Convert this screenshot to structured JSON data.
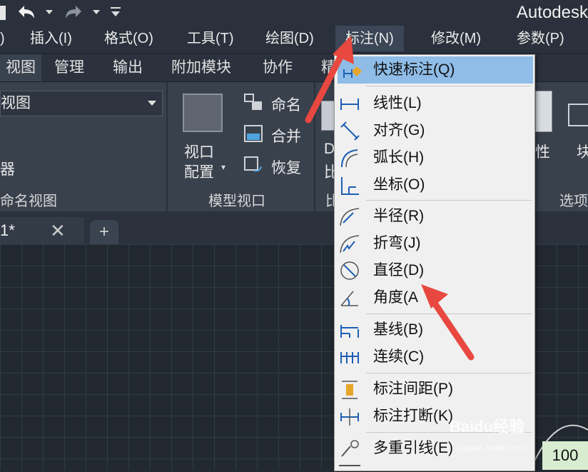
{
  "app": {
    "title": "Autodesk"
  },
  "menubar": {
    "items": [
      {
        "label": ")"
      },
      {
        "label": "插入(I)"
      },
      {
        "label": "格式(O)"
      },
      {
        "label": "工具(T)"
      },
      {
        "label": "绘图(D)"
      },
      {
        "label": "标注(N)"
      },
      {
        "label": "修改(M)"
      },
      {
        "label": "参数(P)"
      }
    ]
  },
  "ribbon_tabs": [
    "视图",
    "管理",
    "输出",
    "附加模块",
    "协作",
    "精"
  ],
  "ribbon": {
    "view_dropdown": "视图",
    "panel1_line": "器",
    "panel1_title": "命名视图",
    "viewport_label1": "视口",
    "viewport_label2": "配置",
    "name_label": "命名",
    "merge_label": "合并",
    "restore_label": "恢复",
    "panel2_title": "模型视口",
    "partial_d": "D",
    "partial_bi": "比",
    "partial_bi2": "比",
    "partial_xing": "性",
    "partial_kuai": "块",
    "partial_xuan": "选项"
  },
  "file_tabs": {
    "current": "1*",
    "close": "✕",
    "add": "+"
  },
  "dropdown": {
    "items": [
      {
        "label": "快速标注(Q)",
        "icon": "quick-dimension-icon",
        "highlighted": true
      },
      {
        "label": "线性(L)",
        "icon": "linear-dimension-icon"
      },
      {
        "label": "对齐(G)",
        "icon": "aligned-dimension-icon"
      },
      {
        "label": "弧长(H)",
        "icon": "arc-length-icon"
      },
      {
        "label": "坐标(O)",
        "icon": "ordinate-icon"
      },
      {
        "label": "半径(R)",
        "icon": "radius-icon"
      },
      {
        "label": "折弯(J)",
        "icon": "jogged-icon"
      },
      {
        "label": "直径(D)",
        "icon": "diameter-icon"
      },
      {
        "label": "角度(A",
        "icon": "angular-icon"
      },
      {
        "label": "基线(B)",
        "icon": "baseline-icon"
      },
      {
        "label": "连续(C)",
        "icon": "continue-icon"
      },
      {
        "label": "标注间距(P)",
        "icon": "dimension-space-icon"
      },
      {
        "label": "标注打断(K)",
        "icon": "dimension-break-icon"
      },
      {
        "label": "多重引线(E)",
        "icon": "multileader-icon"
      }
    ]
  },
  "statusbar": {
    "zoom": "100"
  },
  "watermark": {
    "brand": "Baidu经验",
    "url": "jingyan.baidu.com"
  },
  "colors": {
    "arrow": "#e8483f",
    "highlight": "#8fbde8"
  }
}
